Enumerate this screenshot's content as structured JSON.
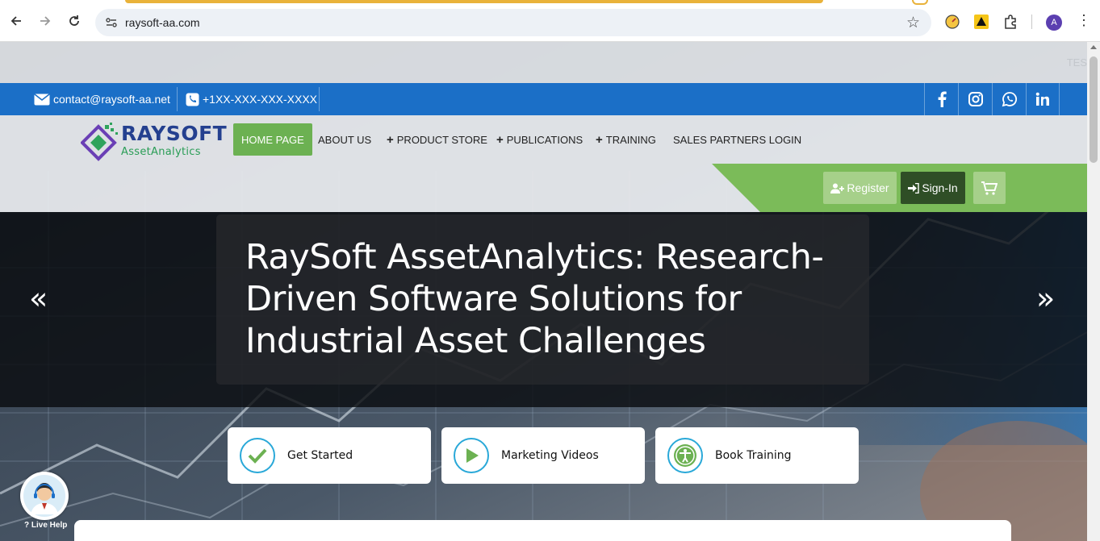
{
  "browser": {
    "url": "raysoft-aa.com",
    "profile_initial": "A"
  },
  "top_strip": {
    "ticker_text": "TES"
  },
  "contact": {
    "email": "contact@raysoft-aa.net",
    "phone": "+1XX-XXX-XXX-XXXX"
  },
  "social": [
    "facebook-icon",
    "instagram-icon",
    "whatsapp-icon",
    "linkedin-icon"
  ],
  "logo": {
    "name": "RAYSOFT",
    "sub": "AssetAnalytics"
  },
  "menu": {
    "home": "HOME PAGE",
    "about": "ABOUT US",
    "product_store": "PRODUCT STORE",
    "publications": "PUBLICATIONS",
    "training": "TRAINING",
    "partners": "SALES PARTNERS LOGIN"
  },
  "account": {
    "register": "Register",
    "signin": "Sign-In"
  },
  "hero": {
    "title": "RaySoft AssetAnalytics: Research-Driven Software Solutions for Industrial Asset Challenges",
    "prev": "«",
    "next": "»"
  },
  "cards": {
    "get_started": "Get Started",
    "marketing_videos": "Marketing Videos",
    "book_training": "Book Training"
  },
  "live_help": {
    "label": "? Live Help"
  },
  "colors": {
    "contact_bar": "#1b6fc7",
    "accent_green": "#6cb152",
    "signin_dark": "#2f4e26",
    "logo_blue": "#24408f"
  }
}
